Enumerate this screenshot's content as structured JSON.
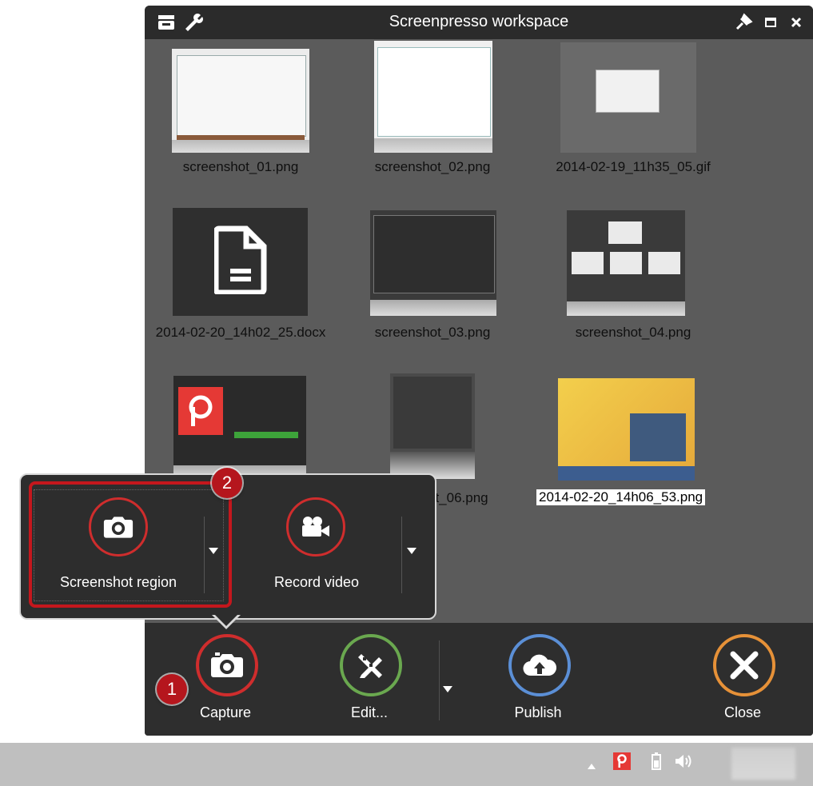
{
  "window": {
    "title": "Screenpresso workspace"
  },
  "toolbar": {
    "left_icons": [
      "workspace-icon",
      "wrench-icon"
    ],
    "right_icons": [
      "pin-icon",
      "maximize-icon",
      "close-icon"
    ]
  },
  "files": [
    {
      "name": "screenshot_01.png"
    },
    {
      "name": "screenshot_02.png"
    },
    {
      "name": "2014-02-19_11h35_05.gif"
    },
    {
      "name": "2014-02-20_14h02_25.docx"
    },
    {
      "name": "screenshot_03.png"
    },
    {
      "name": "screenshot_04.png"
    },
    {
      "name": "2014-02-20_14h06_53.png",
      "selected": true
    },
    {
      "name_partial": "ot_06.png"
    }
  ],
  "popup": {
    "screenshot_label": "Screenshot region",
    "video_label": "Record video"
  },
  "bottombar": {
    "capture": "Capture",
    "edit": "Edit...",
    "publish": "Publish",
    "close": "Close"
  },
  "badges": {
    "one": "1",
    "two": "2"
  },
  "colors": {
    "accent_red": "#cf2d2d",
    "edit_green": "#6aa84f",
    "publish_blue": "#5b8fd6",
    "close_orange": "#e69138"
  }
}
